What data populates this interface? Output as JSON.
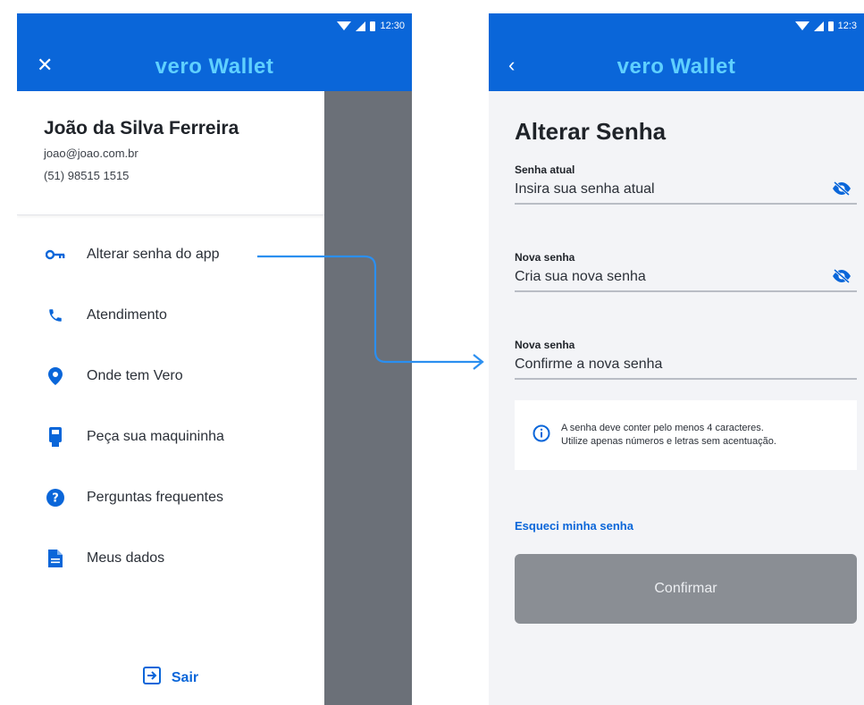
{
  "colors": {
    "primary": "#0a66d9",
    "logo": "#5fd0ff",
    "scrim": "#6b7078",
    "button_disabled": "#8a8e94"
  },
  "left_screen": {
    "status_time": "12:30",
    "logo": "vero Wallet",
    "close_icon": "✕",
    "profile": {
      "name": "João da Silva Ferreira",
      "email": "joao@joao.com.br",
      "phone": "(51) 98515 1515"
    },
    "menu": [
      {
        "label": "Alterar senha do app",
        "icon": "key-icon"
      },
      {
        "label": "Atendimento",
        "icon": "phone-icon"
      },
      {
        "label": "Onde tem Vero",
        "icon": "location-pin-icon"
      },
      {
        "label": "Peça sua maquininha",
        "icon": "card-machine-icon"
      },
      {
        "label": "Perguntas frequentes",
        "icon": "help-circle-icon"
      },
      {
        "label": "Meus dados",
        "icon": "document-icon"
      }
    ],
    "logout_label": "Sair"
  },
  "right_screen": {
    "status_time": "12:3",
    "logo": "vero Wallet",
    "back_icon": "‹",
    "title": "Alterar Senha",
    "fields": [
      {
        "label": "Senha atual",
        "placeholder": "Insira sua senha atual",
        "has_eye": true
      },
      {
        "label": "Nova senha",
        "placeholder": "Cria sua nova senha",
        "has_eye": true
      },
      {
        "label": "Nova senha",
        "placeholder": "Confirme a nova senha",
        "has_eye": false
      }
    ],
    "info_line1": "A senha deve conter pelo menos 4 caracteres.",
    "info_line2": "Utilize apenas números e letras sem acentuação.",
    "forgot_link": "Esqueci minha senha",
    "confirm_label": "Confirmar"
  }
}
